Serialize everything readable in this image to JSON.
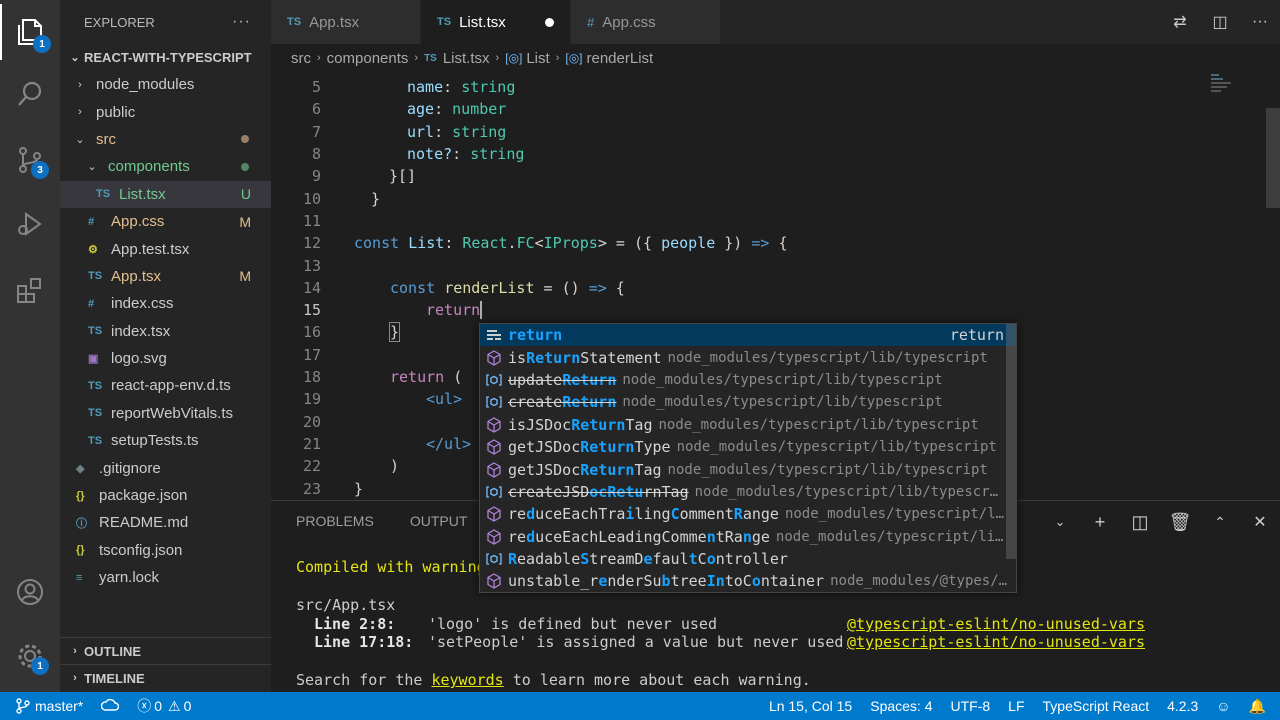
{
  "activity_bar": {
    "explorer_badge": "1",
    "scm_badge": "3",
    "settings_badge": "1"
  },
  "sidebar": {
    "title": "EXPLORER",
    "more": "···",
    "project": "REACT-WITH-TYPESCRIPT",
    "items": [
      {
        "label": "node_modules",
        "icon": "›",
        "status": ""
      },
      {
        "label": "public",
        "icon": "›",
        "status": ""
      },
      {
        "label": "src",
        "icon": "⌄",
        "status": ""
      },
      {
        "label": "components",
        "icon": "⌄",
        "status": ""
      },
      {
        "label": "List.tsx",
        "icon": "TS",
        "status": "U"
      },
      {
        "label": "App.css",
        "icon": "#",
        "status": "M"
      },
      {
        "label": "App.test.tsx",
        "icon": "⚙",
        "status": ""
      },
      {
        "label": "App.tsx",
        "icon": "TS",
        "status": "M"
      },
      {
        "label": "index.css",
        "icon": "#",
        "status": ""
      },
      {
        "label": "index.tsx",
        "icon": "TS",
        "status": ""
      },
      {
        "label": "logo.svg",
        "icon": "▣",
        "status": ""
      },
      {
        "label": "react-app-env.d.ts",
        "icon": "TS",
        "status": ""
      },
      {
        "label": "reportWebVitals.ts",
        "icon": "TS",
        "status": ""
      },
      {
        "label": "setupTests.ts",
        "icon": "TS",
        "status": ""
      },
      {
        "label": ".gitignore",
        "icon": "◆",
        "status": ""
      },
      {
        "label": "package.json",
        "icon": "{}",
        "status": ""
      },
      {
        "label": "README.md",
        "icon": "ⓘ",
        "status": ""
      },
      {
        "label": "tsconfig.json",
        "icon": "{}",
        "status": ""
      },
      {
        "label": "yarn.lock",
        "icon": "≡",
        "status": ""
      }
    ],
    "outline": "OUTLINE",
    "timeline": "TIMELINE",
    "colors": {
      "modified": "#e2c08d",
      "untracked": "#73c991",
      "src": "#e2c08d",
      "components": "#73c991"
    }
  },
  "tabs": [
    {
      "label": "App.tsx",
      "icon": "TS"
    },
    {
      "label": "List.tsx",
      "icon": "TS"
    },
    {
      "label": "App.css",
      "icon": "#"
    }
  ],
  "breadcrumb": {
    "parts": [
      "src",
      "components",
      "List.tsx",
      "List",
      "renderList"
    ]
  },
  "editor": {
    "line_numbers": [
      "5",
      "6",
      "7",
      "8",
      "9",
      "10",
      "11",
      "12",
      "13",
      "14",
      "15",
      "16",
      "17",
      "18",
      "19",
      "20",
      "21",
      "22",
      "23"
    ],
    "code": {
      "l5_prop": "name",
      "l5_type": "string",
      "l6_prop": "age",
      "l6_type": "number",
      "l7_prop": "url",
      "l7_type": "string",
      "l8_prop": "note?",
      "l8_type": "string",
      "l9": "}[]",
      "l10": "}",
      "l12_const": "const",
      "l12_name": "List",
      "l12_react": "React",
      "l12_fc": "FC",
      "l12_iprops": "IProps",
      "l12_people": "people",
      "l14_const": "const",
      "l14_name": "renderList",
      "l15": "return",
      "l16": "}",
      "l18": "return",
      "l19": "<ul>",
      "l21": "</ul>",
      "l22": ")",
      "l23": "}"
    }
  },
  "suggest": {
    "items": [
      {
        "label": "return",
        "desc": "",
        "right": "return",
        "kind": "keyword"
      },
      {
        "label": "isReturnStatement",
        "desc": "node_modules/typescript/lib/typescript",
        "kind": "method"
      },
      {
        "label": "updateReturn",
        "desc": "node_modules/typescript/lib/typescript",
        "kind": "deprecated"
      },
      {
        "label": "createReturn",
        "desc": "node_modules/typescript/lib/typescript",
        "kind": "deprecated"
      },
      {
        "label": "isJSDocReturnTag",
        "desc": "node_modules/typescript/lib/typescript",
        "kind": "method"
      },
      {
        "label": "getJSDocReturnType",
        "desc": "node_modules/typescript/lib/typescript",
        "kind": "method"
      },
      {
        "label": "getJSDocReturnTag",
        "desc": "node_modules/typescript/lib/typescript",
        "kind": "method"
      },
      {
        "label": "createJSDocReturnTag",
        "desc": "node_modules/typescript/lib/typescr…",
        "kind": "deprecated"
      },
      {
        "label": "reduceEachTrailingCommentRange",
        "desc": "node_modules/typescript/l…",
        "kind": "method"
      },
      {
        "label": "reduceEachLeadingCommentRange",
        "desc": "node_modules/typescript/li…",
        "kind": "method"
      },
      {
        "label": "ReadableStreamDefaultController",
        "desc": "",
        "kind": "variable"
      },
      {
        "label": "unstable_renderSubtreeIntoContainer",
        "desc": "node_modules/@types/…",
        "kind": "method"
      }
    ]
  },
  "panel": {
    "tabs": [
      "PROBLEMS",
      "OUTPUT",
      "T"
    ],
    "compiled": "Compiled with warning",
    "file": "src/App.tsx",
    "w1_loc": "Line 2:8:",
    "w1_msg": "'logo' is defined but never used",
    "w1_rule": "@typescript-eslint/no-unused-vars",
    "w2_loc": "Line 17:18:",
    "w2_msg": "'setPeople' is assigned a value but never used",
    "w2_rule": "@typescript-eslint/no-unused-vars",
    "search_pre": "Search for the",
    "search_link": "keywords",
    "search_post": "to learn more about each warning."
  },
  "status": {
    "branch": "master*",
    "errors": "0",
    "warnings": "0",
    "position": "Ln 15, Col 15",
    "spaces": "Spaces: 4",
    "encoding": "UTF-8",
    "eol": "LF",
    "language": "TypeScript React",
    "version": "4.2.3"
  }
}
